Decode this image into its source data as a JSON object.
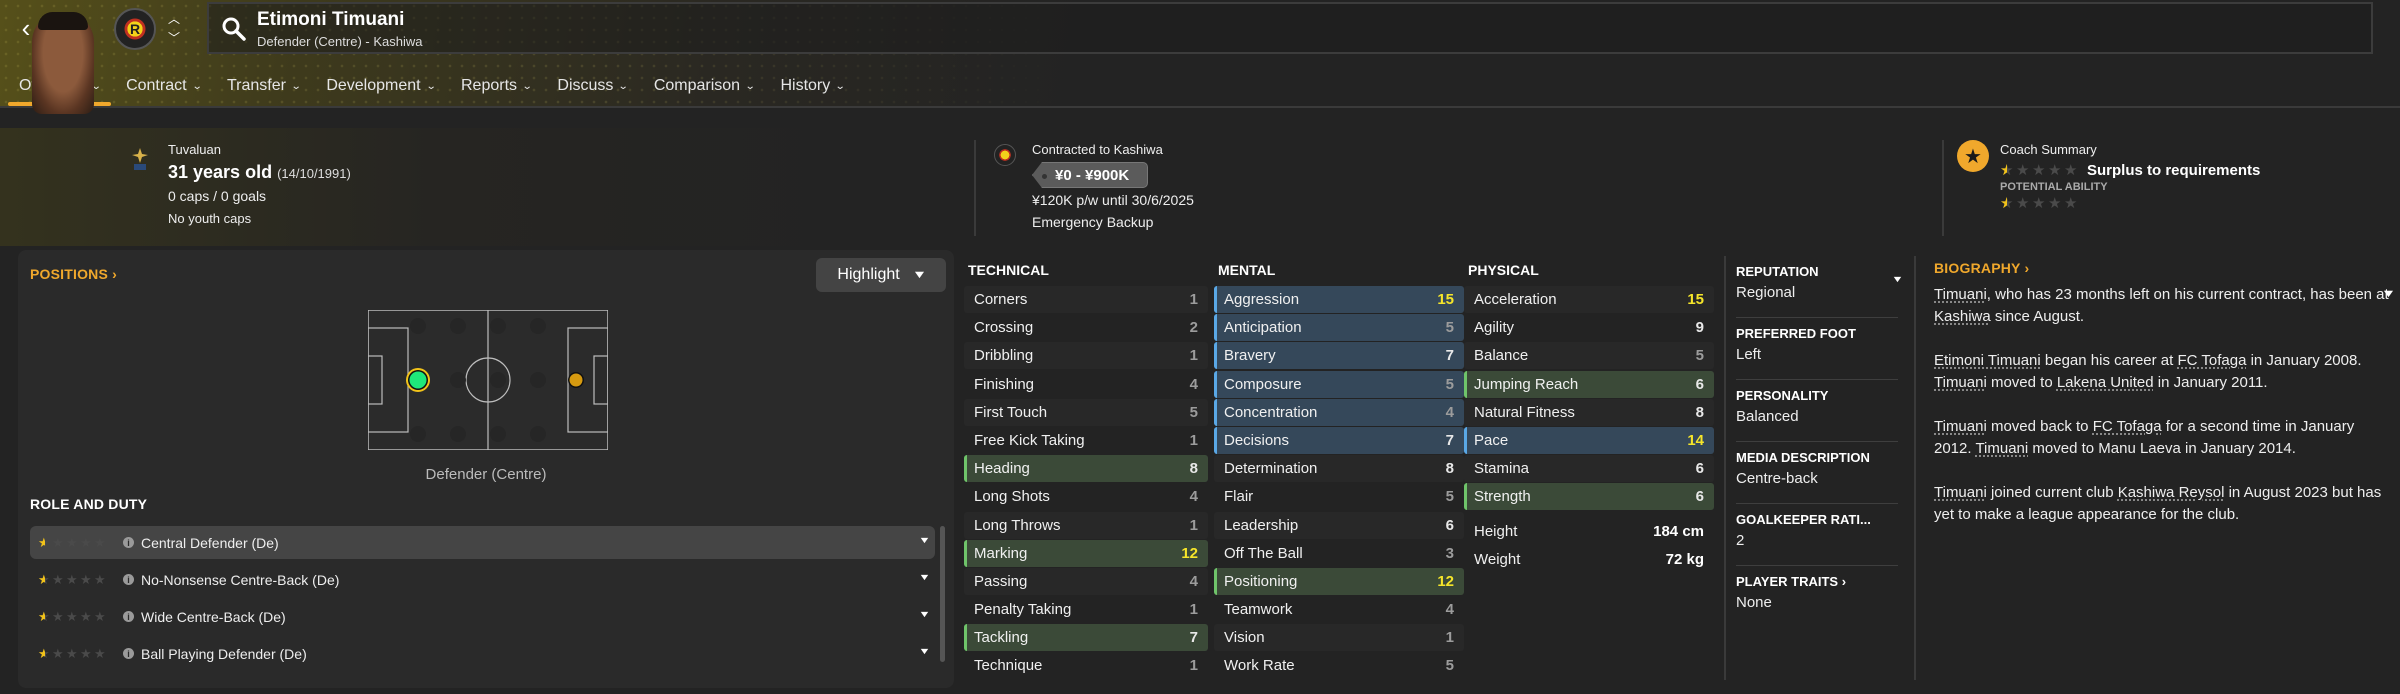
{
  "header": {
    "player_name": "Etimoni Timuani",
    "player_subtitle": "Defender (Centre) - Kashiwa",
    "club_badge": "kashiwa-reysol-badge",
    "tabs": [
      {
        "label": "Overview",
        "active": true
      },
      {
        "label": "Contract"
      },
      {
        "label": "Transfer"
      },
      {
        "label": "Development"
      },
      {
        "label": "Reports"
      },
      {
        "label": "Discuss"
      },
      {
        "label": "Comparison"
      },
      {
        "label": "History"
      }
    ]
  },
  "profile": {
    "nationality": "Tuvaluan",
    "age": "31 years old",
    "dob": "(14/10/1991)",
    "caps": "0 caps / 0 goals",
    "youth_caps": "No youth caps",
    "contract_club": "Contracted to Kashiwa",
    "value_range": "¥0 - ¥900K",
    "wage": "¥120K p/w until 30/6/2025",
    "squad_status": "Emergency Backup",
    "coach_summary_label": "Coach Summary",
    "current_ability_stars": 0.5,
    "coach_summary_text": "Surplus to requirements",
    "potential_label": "POTENTIAL ABILITY",
    "potential_ability_stars": 0.5
  },
  "positions": {
    "title": "POSITIONS",
    "highlight_label": "Highlight",
    "position_label": "Defender (Centre)",
    "natural_position": "D (C)",
    "other_position": "ST (C)",
    "role_title": "ROLE AND DUTY",
    "roles": [
      {
        "name": "Central Defender (De)",
        "stars": 0.5,
        "selected": true
      },
      {
        "name": "No-Nonsense Centre-Back (De)",
        "stars": 0.5
      },
      {
        "name": "Wide Centre-Back (De)",
        "stars": 0.5
      },
      {
        "name": "Ball Playing Defender (De)",
        "stars": 0.5
      }
    ]
  },
  "attributes": {
    "technical": {
      "title": "TECHNICAL",
      "items": [
        {
          "name": "Corners",
          "value": 1
        },
        {
          "name": "Crossing",
          "value": 2
        },
        {
          "name": "Dribbling",
          "value": 1
        },
        {
          "name": "Finishing",
          "value": 4
        },
        {
          "name": "First Touch",
          "value": 5
        },
        {
          "name": "Free Kick Taking",
          "value": 1
        },
        {
          "name": "Heading",
          "value": 8,
          "hl": "green"
        },
        {
          "name": "Long Shots",
          "value": 4
        },
        {
          "name": "Long Throws",
          "value": 1
        },
        {
          "name": "Marking",
          "value": 12,
          "hl": "green"
        },
        {
          "name": "Passing",
          "value": 4
        },
        {
          "name": "Penalty Taking",
          "value": 1
        },
        {
          "name": "Tackling",
          "value": 7,
          "hl": "green"
        },
        {
          "name": "Technique",
          "value": 1
        }
      ]
    },
    "mental": {
      "title": "MENTAL",
      "items": [
        {
          "name": "Aggression",
          "value": 15,
          "hl": "blue"
        },
        {
          "name": "Anticipation",
          "value": 5,
          "hl": "blue"
        },
        {
          "name": "Bravery",
          "value": 7,
          "hl": "blue"
        },
        {
          "name": "Composure",
          "value": 5,
          "hl": "blue"
        },
        {
          "name": "Concentration",
          "value": 4,
          "hl": "blue"
        },
        {
          "name": "Decisions",
          "value": 7,
          "hl": "blue"
        },
        {
          "name": "Determination",
          "value": 8
        },
        {
          "name": "Flair",
          "value": 5
        },
        {
          "name": "Leadership",
          "value": 6
        },
        {
          "name": "Off The Ball",
          "value": 3
        },
        {
          "name": "Positioning",
          "value": 12,
          "hl": "green"
        },
        {
          "name": "Teamwork",
          "value": 4
        },
        {
          "name": "Vision",
          "value": 1
        },
        {
          "name": "Work Rate",
          "value": 5
        }
      ]
    },
    "physical": {
      "title": "PHYSICAL",
      "items": [
        {
          "name": "Acceleration",
          "value": 15
        },
        {
          "name": "Agility",
          "value": 9
        },
        {
          "name": "Balance",
          "value": 5
        },
        {
          "name": "Jumping Reach",
          "value": 6,
          "hl": "green"
        },
        {
          "name": "Natural Fitness",
          "value": 8
        },
        {
          "name": "Pace",
          "value": 14,
          "hl": "blue"
        },
        {
          "name": "Stamina",
          "value": 6
        },
        {
          "name": "Strength",
          "value": 6,
          "hl": "green"
        }
      ],
      "extras": [
        {
          "name": "Height",
          "value": "184 cm"
        },
        {
          "name": "Weight",
          "value": "72 kg"
        }
      ]
    }
  },
  "side_info": [
    {
      "label": "REPUTATION",
      "value": "Regional",
      "dropdown": true
    },
    {
      "label": "PREFERRED FOOT",
      "value": "Left"
    },
    {
      "label": "PERSONALITY",
      "value": "Balanced"
    },
    {
      "label": "MEDIA DESCRIPTION",
      "value": "Centre-back"
    },
    {
      "label": "GOALKEEPER RATI...",
      "value": "2"
    },
    {
      "label": "PLAYER TRAITS",
      "value": "None",
      "link": true
    }
  ],
  "biography": {
    "title": "BIOGRAPHY",
    "paragraphs": [
      [
        {
          "t": " "
        },
        {
          "t": "Timuani",
          "link": true
        },
        {
          "t": ", who has 23 months left on his current contract, has been at "
        },
        {
          "t": "Kashiwa",
          "link": true
        },
        {
          "t": " since August."
        }
      ],
      [
        {
          "t": "Etimoni Timuani",
          "link": true
        },
        {
          "t": " began his career at "
        },
        {
          "t": "FC Tofaga",
          "link": true
        },
        {
          "t": " in January 2008. "
        },
        {
          "t": "Timuani",
          "link": true
        },
        {
          "t": " moved to "
        },
        {
          "t": "Lakena United",
          "link": true
        },
        {
          "t": " in January 2011."
        }
      ],
      [
        {
          "t": "Timuani",
          "link": true
        },
        {
          "t": " moved back to "
        },
        {
          "t": "FC Tofaga",
          "link": true
        },
        {
          "t": " for a second time in January 2012. "
        },
        {
          "t": "Timuani",
          "link": true
        },
        {
          "t": " moved to Manu Laeva in January 2014."
        }
      ],
      [
        {
          "t": "Timuani",
          "link": true
        },
        {
          "t": " joined current club "
        },
        {
          "t": "Kashiwa Reysol",
          "link": true
        },
        {
          "t": " in August 2023 but has yet to make a league appearance for the club."
        }
      ]
    ]
  },
  "colors": {
    "accent": "#f0a82c",
    "highlight_green": "#3b4a38",
    "highlight_blue": "#35485a",
    "high_value": "#f5e52a",
    "natural_position": "#1ee87a",
    "other_position": "#d69a10"
  }
}
